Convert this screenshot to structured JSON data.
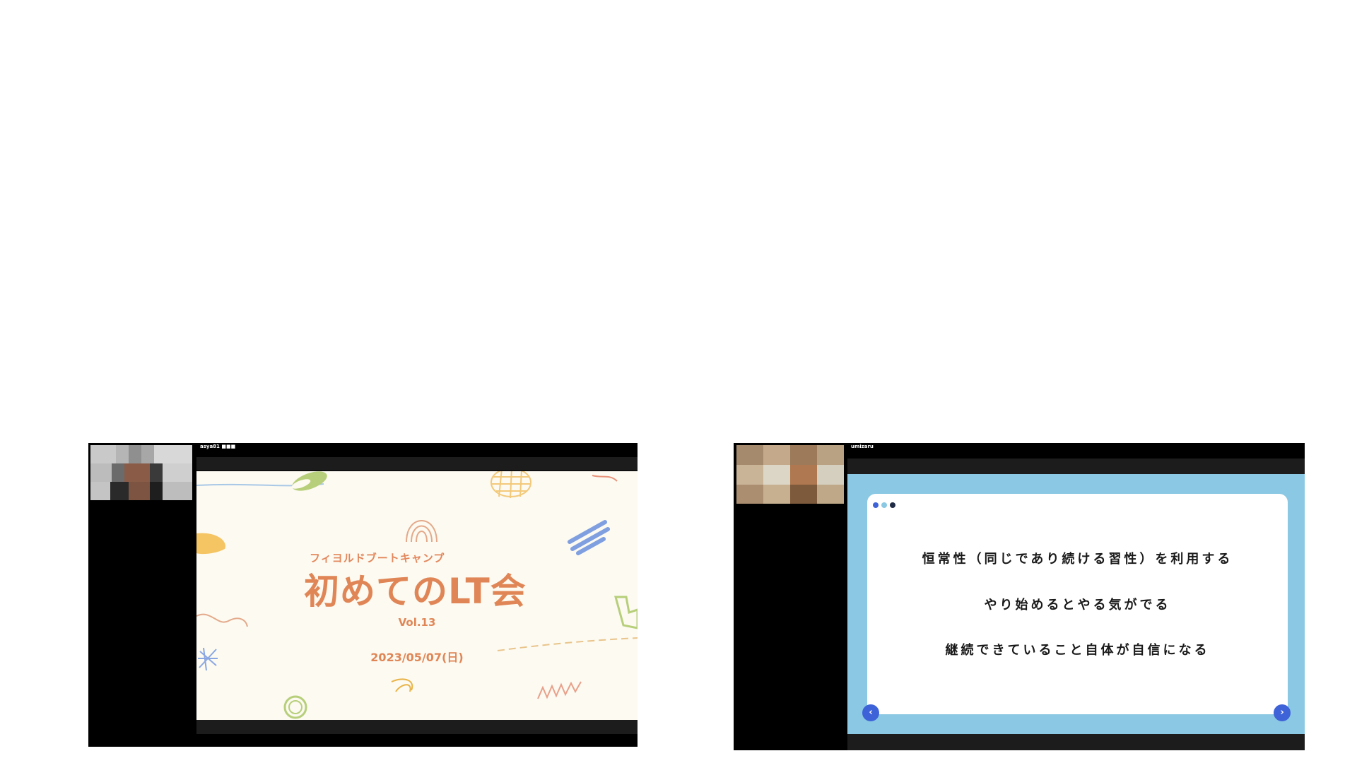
{
  "left_panel": {
    "participant_name": "asya81 ■■■",
    "slide": {
      "subtitle": "フィヨルドブートキャンプ",
      "title": "初めてのLT会",
      "volume": "Vol.13",
      "date": "2023/05/07(日)"
    },
    "colors": {
      "accent": "#e08656",
      "slide_background": "#fcfaf1"
    }
  },
  "right_panel": {
    "participant_name": "umizaru",
    "slide": {
      "lines": [
        "恒常性（同じであり続ける習性）を利用する",
        "やり始めるとやる気がでる",
        "継続できていること自体が自信になる"
      ],
      "prev_icon": "chevron-left-icon",
      "next_icon": "chevron-right-icon"
    },
    "colors": {
      "frame": "#8ac8e3",
      "card": "#ffffff",
      "nav_button": "#3e63d8"
    }
  }
}
